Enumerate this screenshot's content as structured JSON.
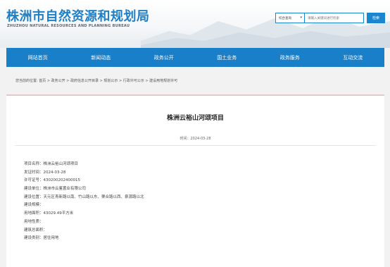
{
  "header": {
    "title_cn": "株洲市自然资源和规划局",
    "title_en": "ZHUZHOU NATURAL RESOURCES AND PLANNING BUREAU"
  },
  "search": {
    "select_value": "综合查询",
    "placeholder": "请输入关键词进行检索",
    "button_label": "检索"
  },
  "nav": {
    "items": [
      "网站首页",
      "新闻动态",
      "政务公开",
      "国土业务",
      "政务服务",
      "互动交流"
    ]
  },
  "breadcrumb": "您当前的位置:  首页 > 政务公开 > 政府信息公开目录 > 规划公示 > 行政许可公示 > 建设用地规划许可",
  "article": {
    "title": "株洲云裕山河颂项目",
    "time": "时间：2024-03-28",
    "fields": [
      "项目名称：株洲云裕山河颂项目",
      "发证时间：2024-03-28",
      "许可证号：430200202400015",
      "建设单位：株洲市云鉴置业有限公司",
      "建设位置：天元区青新路以南、竹山路以东、栗合路以西、泉源路以北",
      "建设规模：",
      "用地面积：43029.49平方米",
      "用地性质：",
      "建筑总面积：",
      "建设类别：居住用地"
    ]
  }
}
